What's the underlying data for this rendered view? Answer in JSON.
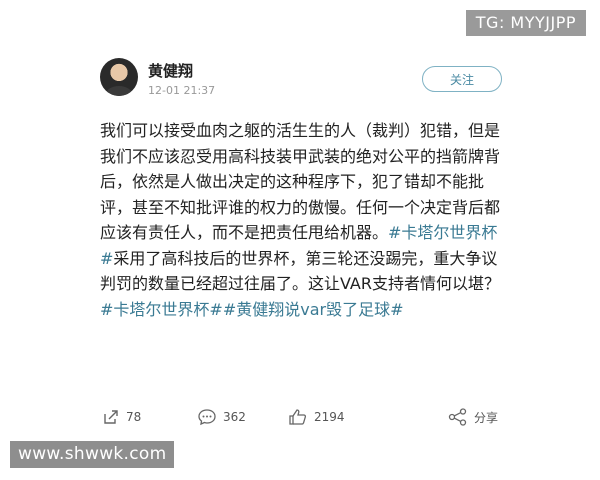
{
  "watermarks": {
    "top": "TG: MYYJJPP",
    "bottom": "www.shwwk.com"
  },
  "post": {
    "author": "黄健翔",
    "timestamp": "12-01 21:37",
    "follow_label": "关注",
    "body": [
      {
        "text": "我们可以接受血肉之躯的活生生的人（裁判）犯错，但是我们不应该忍受用高科技装甲武装的绝对公平的挡箭牌背后，依然是人做出决定的这种程序下，犯了错却不能批评，甚至不知批评谁的权力的傲慢。任何一个决定背后都应该有责任人，而不是把责任甩给机器。",
        "tag": false
      },
      {
        "text": "#卡塔尔世界杯#",
        "tag": true
      },
      {
        "text": "采用了高科技后的世界杯，第三轮还没踢完，重大争议判罚的数量已经超过往届了。这让VAR支持者情何以堪？",
        "tag": false
      },
      {
        "text": "#卡塔尔世界杯#",
        "tag": true
      },
      {
        "text": "#黄健翔说var毁了足球#",
        "tag": true
      }
    ]
  },
  "actions": {
    "repost_count": "78",
    "comment_count": "362",
    "like_count": "2194",
    "share_label": "分享"
  },
  "colors": {
    "tag": "#3a7a93",
    "follow_border": "#7fb2c4",
    "text": "#222222",
    "muted": "#999999"
  }
}
